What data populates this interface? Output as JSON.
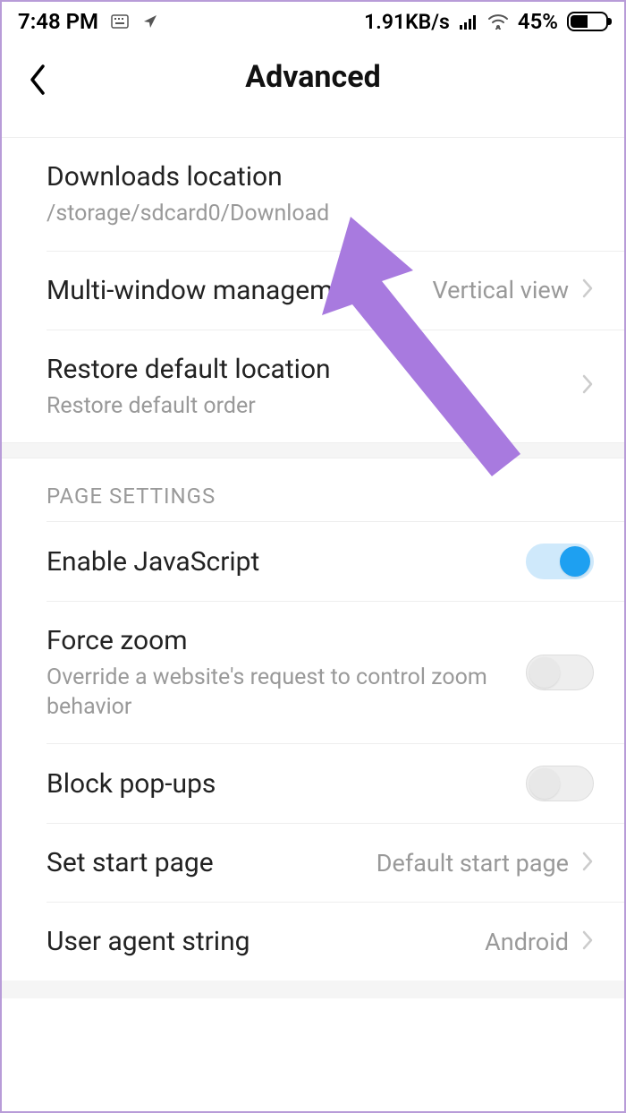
{
  "status": {
    "time": "7:48 PM",
    "speed": "1.91KB/s",
    "battery_pct": "45%"
  },
  "header": {
    "title": "Advanced"
  },
  "items": {
    "downloads": {
      "title": "Downloads location",
      "subtitle": "/storage/sdcard0/Download"
    },
    "multiwindow": {
      "title": "Multi-window management",
      "value": "Vertical view"
    },
    "restore": {
      "title": "Restore default location",
      "subtitle": "Restore default order"
    }
  },
  "section": {
    "page_settings": "PAGE SETTINGS"
  },
  "page_items": {
    "javascript": {
      "title": "Enable JavaScript",
      "on": true
    },
    "forcezoom": {
      "title": "Force zoom",
      "subtitle": "Override a website's request to control zoom behavior",
      "on": false
    },
    "blockpopups": {
      "title": "Block pop-ups",
      "on": false
    },
    "startpage": {
      "title": "Set start page",
      "value": "Default start page"
    },
    "useragent": {
      "title": "User agent string",
      "value": "Android"
    }
  },
  "colors": {
    "arrow": "#a87adf"
  }
}
